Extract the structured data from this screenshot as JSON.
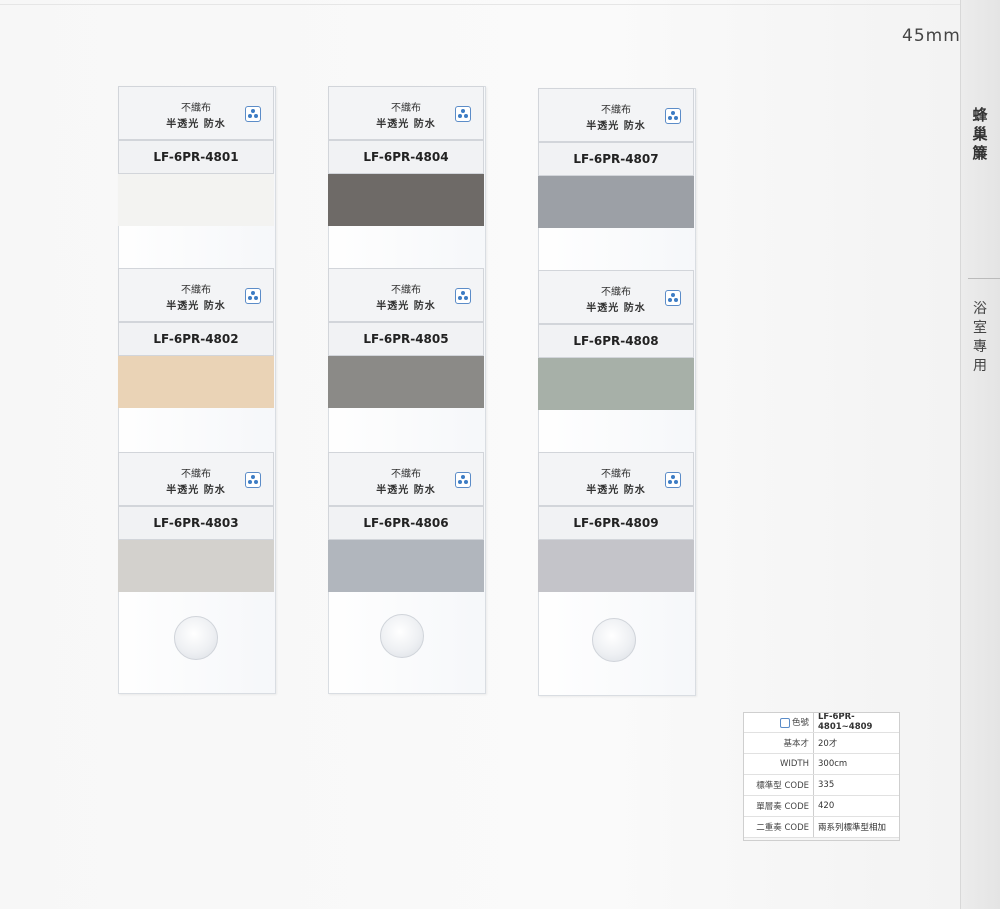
{
  "header": {
    "size_label": "45mm"
  },
  "side_tab": {
    "title": "蜂巢簾",
    "subtitle": "浴室專用"
  },
  "label_text": {
    "line1": "不織布",
    "line2": "半透光 防水"
  },
  "swatches": [
    {
      "code": "LF-6PR-4801",
      "color": "#f3f3f1"
    },
    {
      "code": "LF-6PR-4802",
      "color": "#ead3b6"
    },
    {
      "code": "LF-6PR-4803",
      "color": "#d3d1cd"
    },
    {
      "code": "LF-6PR-4804",
      "color": "#6e6a67"
    },
    {
      "code": "LF-6PR-4805",
      "color": "#8b8a87"
    },
    {
      "code": "LF-6PR-4806",
      "color": "#b1b6bd"
    },
    {
      "code": "LF-6PR-4807",
      "color": "#9ca0a6"
    },
    {
      "code": "LF-6PR-4808",
      "color": "#a7b0a8"
    },
    {
      "code": "LF-6PR-4809",
      "color": "#c4c4c9"
    }
  ],
  "spec_table": {
    "rows": [
      {
        "label": "色號",
        "value": "LF-6PR-4801~4809"
      },
      {
        "label": "基本才",
        "value": "20才"
      },
      {
        "label": "WIDTH",
        "value": "300cm"
      },
      {
        "label": "標準型 CODE",
        "value": "335"
      },
      {
        "label": "單層奏 CODE",
        "value": "420"
      },
      {
        "label": "二重奏 CODE",
        "value": "兩系列標準型相加"
      }
    ]
  }
}
